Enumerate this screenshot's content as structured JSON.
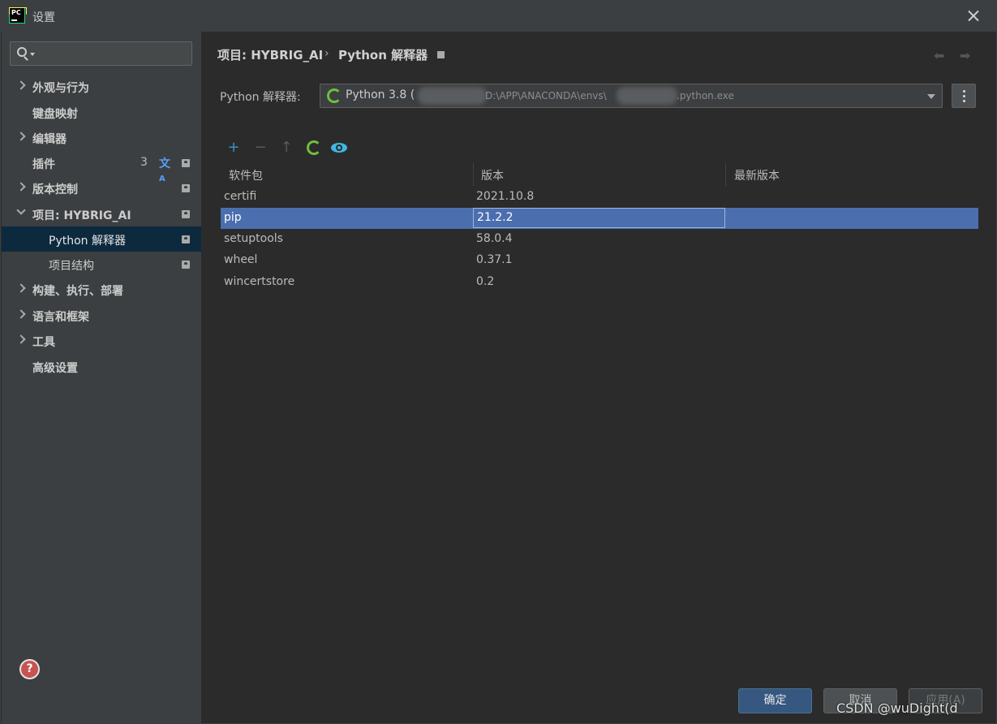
{
  "window": {
    "title": "设置"
  },
  "search": {
    "placeholder": "",
    "value": ""
  },
  "sidebar": {
    "items": [
      {
        "label": "外观与行为",
        "expandable": true
      },
      {
        "label": "键盘映射"
      },
      {
        "label": "编辑器",
        "expandable": true
      },
      {
        "label": "插件",
        "count": "3"
      },
      {
        "label": "版本控制",
        "expandable": true
      },
      {
        "label": "项目: HYBRIG_AI",
        "expandable": true,
        "expanded": true
      },
      {
        "label": "Python 解释器",
        "selected": true
      },
      {
        "label": "项目结构"
      },
      {
        "label": "构建、执行、部署",
        "expandable": true
      },
      {
        "label": "语言和框架",
        "expandable": true
      },
      {
        "label": "工具",
        "expandable": true
      },
      {
        "label": "高级设置"
      }
    ]
  },
  "breadcrumb": {
    "project": "项目: HYBRIG_AI",
    "separator": "›",
    "current": "Python 解释器"
  },
  "interpreter": {
    "label": "Python 解释器:",
    "name": "Python 3.8 (",
    "path_part1": "D:\\APP\\ANACONDA\\envs\\",
    "path_part2": ".python.exe"
  },
  "toolbar": {
    "add": "+",
    "remove": "−",
    "upgrade": "↑"
  },
  "table": {
    "headers": [
      "软件包",
      "版本",
      "最新版本"
    ],
    "rows": [
      {
        "package": "certifi",
        "version": "2021.10.8",
        "latest": ""
      },
      {
        "package": "pip",
        "version": "21.2.2",
        "latest": "",
        "selected": true
      },
      {
        "package": "setuptools",
        "version": "58.0.4",
        "latest": ""
      },
      {
        "package": "wheel",
        "version": "0.37.1",
        "latest": ""
      },
      {
        "package": "wincertstore",
        "version": "0.2",
        "latest": ""
      }
    ]
  },
  "buttons": {
    "ok": "确定",
    "cancel": "取消",
    "apply": "应用(A)"
  },
  "help": "?",
  "watermark": "CSDN @wuDight(d",
  "colors": {
    "selection": "#4b6eaf",
    "sidebar_selected": "#0d293e",
    "accent": "#3592c4",
    "conda_green": "#6fbf3a"
  }
}
